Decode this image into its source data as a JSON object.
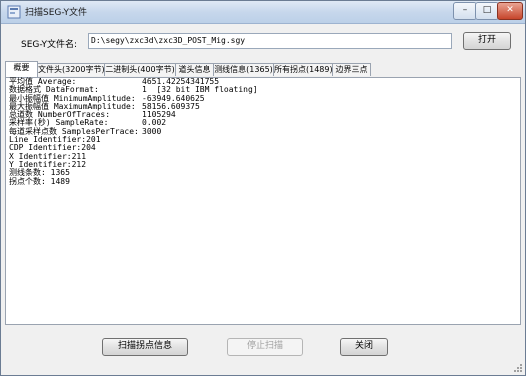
{
  "window": {
    "title": "扫描SEG-Y文件",
    "controls": {
      "minimize": "–",
      "maximize": "□",
      "close": "✕"
    }
  },
  "file_row": {
    "label": "SEG-Y文件名:",
    "path": "D:\\segy\\zxc3d\\zxc3D_POST_Mig.sgy",
    "open_button": "打开"
  },
  "tabs": [
    {
      "label": "概要",
      "active": true
    },
    {
      "label": "文件头(3200字节)",
      "active": false
    },
    {
      "label": "二进制头(400字节)",
      "active": false
    },
    {
      "label": "道头信息",
      "active": false
    },
    {
      "label": "测线信息(1365)",
      "active": false
    },
    {
      "label": "所有拐点(1489)",
      "active": false
    },
    {
      "label": "边界三点",
      "active": false
    }
  ],
  "summary": [
    {
      "key": "平均值 Average:",
      "value": "4651.42254341755"
    },
    {
      "key": "数据格式 DataFormat:",
      "value": "1  [32 bit IBM floating]"
    },
    {
      "key": "最小振幅值 MinimumAmplitude:",
      "value": "-63949.640625"
    },
    {
      "key": "最大振幅值 MaximumAmplitude:",
      "value": "58156.609375"
    },
    {
      "key": "总道数 NumberOfTraces:",
      "value": "1105294"
    },
    {
      "key": "采样率(秒) SampleRate:",
      "value": "0.002"
    },
    {
      "key": "每道采样点数 SamplesPerTrace:",
      "value": "3000"
    },
    {
      "key": "Line Identifier:201",
      "value": ""
    },
    {
      "key": "CDP Identifier:204",
      "value": ""
    },
    {
      "key": "X Identifier:211",
      "value": ""
    },
    {
      "key": "Y Identifier:212",
      "value": ""
    },
    {
      "key": "测线条数: 1365",
      "value": ""
    },
    {
      "key": "拐点个数: 1489",
      "value": ""
    }
  ],
  "footer": {
    "scan_button": "扫描拐点信息",
    "stop_button": "停止扫描",
    "close_button": "关闭"
  },
  "colors": {
    "titlebar": "#c7d7ec",
    "background": "#f0f0f0",
    "disabled_text": "#a0a0a0"
  }
}
